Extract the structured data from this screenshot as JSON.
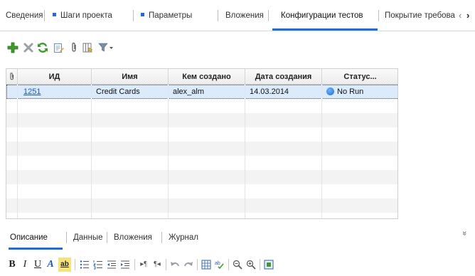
{
  "tabs": {
    "items": [
      {
        "label": "Сведения",
        "dot": false
      },
      {
        "label": "Шаги проекта",
        "dot": true
      },
      {
        "label": "Параметры",
        "dot": true
      },
      {
        "label": "Вложения",
        "dot": false
      },
      {
        "label": "Конфигурации тестов",
        "dot": false,
        "active": true
      },
      {
        "label": "Покрытие требова",
        "dot": false
      }
    ],
    "prev_arrow": "‹",
    "next_arrow": "›"
  },
  "toolbar": {
    "icons": [
      "add-icon",
      "delete-icon",
      "refresh-icon",
      "edit-details-icon",
      "attachment-icon",
      "columns-icon",
      "filter-icon"
    ]
  },
  "grid": {
    "columns": [
      "",
      "ИД",
      "Имя",
      "Кем создано",
      "Дата создания",
      "Статус..."
    ],
    "rows": [
      {
        "id": "1251",
        "name": "Credit Cards",
        "created_by": "alex_alm",
        "created_date": "14.03.2014",
        "status": "No Run"
      }
    ]
  },
  "bottom_tabs": {
    "items": [
      "Описание",
      "Данные",
      "Вложения",
      "Журнал"
    ],
    "active": "Описание",
    "collapse_glyph": "»"
  },
  "format_toolbar": {
    "bold": "B",
    "italic": "I",
    "underline": "U",
    "font_color": "A",
    "highlight": "ab"
  },
  "colors": {
    "accent": "#1f6fd0",
    "selected_row": "#dcebfb",
    "add_icon": "#3f9b2a",
    "delete_icon": "#9aa0a6",
    "refresh_icon": "#3f9b2a"
  }
}
